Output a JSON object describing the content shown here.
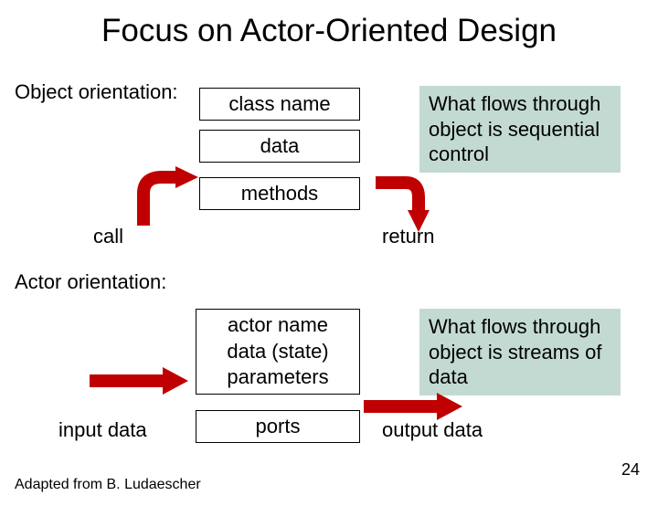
{
  "title": "Focus on Actor-Oriented Design",
  "object_label": "Object orientation:",
  "actor_label": "Actor orientation:",
  "obj_box": {
    "class_name": "class name",
    "data": "data",
    "methods": "methods"
  },
  "call": "call",
  "ret": "return",
  "callout1": "What flows through object is sequential control",
  "actor_box": {
    "actor_name": "actor name",
    "state": "data (state)",
    "params": "parameters",
    "ports": "ports"
  },
  "input_data": "input data",
  "output_data": "output data",
  "callout2": "What flows through object is streams of data",
  "credit": "Adapted from B. Ludaescher",
  "page": "24"
}
